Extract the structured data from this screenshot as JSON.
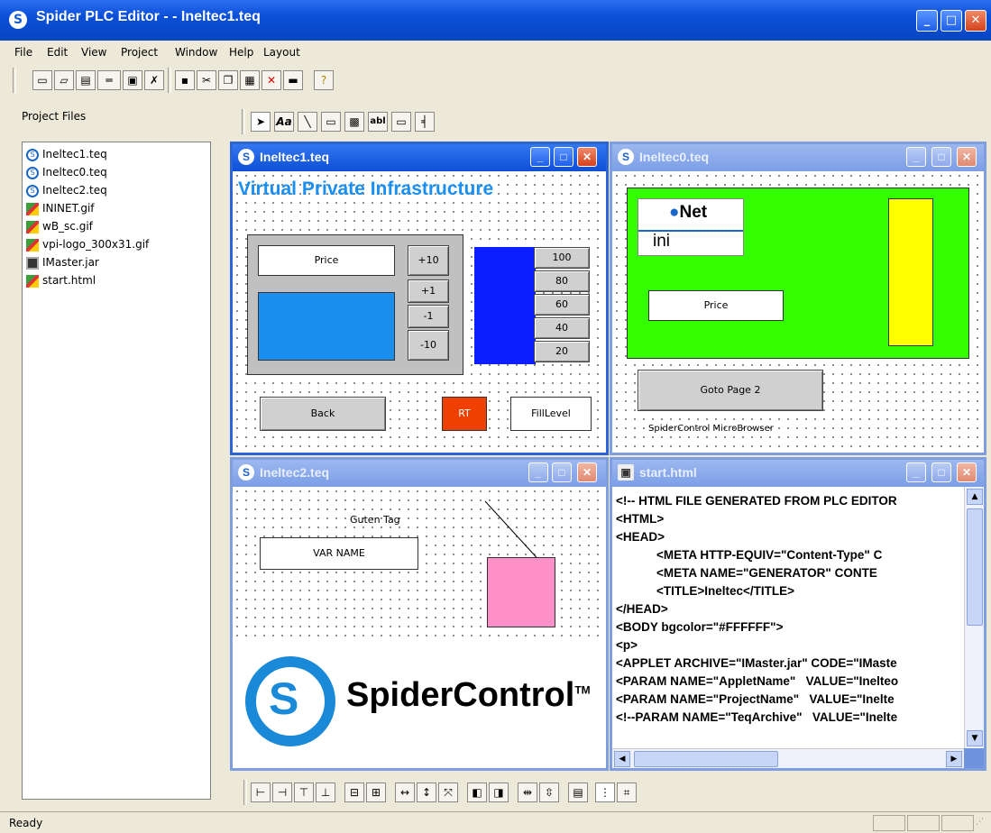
{
  "app": {
    "title": "Spider PLC Editor - - Ineltec1.teq",
    "icon": "spider-app-icon",
    "controls": {
      "minimize": "_",
      "maximize": "□",
      "close": "✕"
    }
  },
  "menu": [
    "File",
    "Edit",
    "View",
    "Project",
    "Window",
    "Help",
    "Layout"
  ],
  "toolbar_icons": [
    "new-icon",
    "open-icon",
    "save-all-icon",
    "rename-icon",
    "print-preview-icon",
    "close-file-icon",
    "save-icon",
    "cut-icon",
    "copy-icon",
    "paste-icon",
    "delete-icon",
    "print-icon",
    "help-icon"
  ],
  "project_panel": {
    "label": "Project Files",
    "files": [
      {
        "name": "Ineltec1.teq",
        "type": "teq"
      },
      {
        "name": "Ineltec0.teq",
        "type": "teq"
      },
      {
        "name": "Ineltec2.teq",
        "type": "teq"
      },
      {
        "name": "ININET.gif",
        "type": "gif"
      },
      {
        "name": "wB_sc.gif",
        "type": "gif"
      },
      {
        "name": "vpi-logo_300x31.gif",
        "type": "gif"
      },
      {
        "name": "IMaster.jar",
        "type": "jar"
      },
      {
        "name": "start.html",
        "type": "gif"
      }
    ]
  },
  "draw_tools": [
    "pointer-tool-icon",
    "text-tool-icon",
    "line-tool-icon",
    "rectangle-tool-icon",
    "image-tool-icon",
    "textfield-tool-icon",
    "button-tool-icon",
    "bar-tool-icon"
  ],
  "draw_tool_labels": {
    "text": "Aa",
    "textfield": "abl"
  },
  "win1": {
    "title": "Ineltec1.teq",
    "banner": [
      "Virtual",
      "Private",
      "Infrastructure"
    ],
    "price": "Price",
    "steps": [
      "+10",
      "+1",
      "-1",
      "-10"
    ],
    "scale": [
      "100",
      "80",
      "60",
      "40",
      "20"
    ],
    "back": "Back",
    "rt": "RT",
    "fill": "FillLevel",
    "colors": {
      "blue": "#1a8ff0",
      "bar": "#0a1eff",
      "rt": "#f04000"
    }
  },
  "win0": {
    "title": "Ineltec0.teq",
    "net_logo": {
      "top": "Net",
      "bottom": "ini"
    },
    "price": "Price",
    "goto": "Goto Page 2",
    "footer": "SpiderControl MicroBrowser",
    "colors": {
      "green": "#33ff00",
      "yellow": "#ffff00"
    }
  },
  "win2": {
    "title": "Ineltec2.teq",
    "greeting": "Guten Tag",
    "var": "VAR NAME",
    "brand": "SpiderControl",
    "tm": "TM",
    "colors": {
      "pink": "#ff90c8",
      "brand": "#1a8ad8"
    }
  },
  "winhtml": {
    "title": "start.html",
    "lines": [
      "<!-- HTML FILE GENERATED FROM PLC EDITOR",
      "<HTML>",
      "<HEAD>",
      "            <META HTTP-EQUIV=\"Content-Type\" C",
      "            <META NAME=\"GENERATOR\" CONTE",
      "            <TITLE>Ineltec</TITLE>",
      "</HEAD>",
      "<BODY bgcolor=\"#FFFFFF\">",
      "<p>",
      "<APPLET ARCHIVE=\"IMaster.jar\" CODE=\"IMaste",
      "<PARAM NAME=\"AppletName\"   VALUE=\"Inelteo",
      "<PARAM NAME=\"ProjectName\"   VALUE=\"Inelte",
      "<!--PARAM NAME=\"TeqArchive\"   VALUE=\"Inelte"
    ]
  },
  "layout_tools": [
    "align-left-icon",
    "align-right-icon",
    "align-top-icon",
    "align-bottom-icon",
    "center-horizontal-icon",
    "center-vertical-icon",
    "same-width-icon",
    "same-height-icon",
    "same-size-icon",
    "bring-front-icon",
    "send-back-icon",
    "space-across-icon",
    "space-down-icon",
    "properties-icon",
    "grid-icon",
    "snap-icon"
  ],
  "status": "Ready"
}
